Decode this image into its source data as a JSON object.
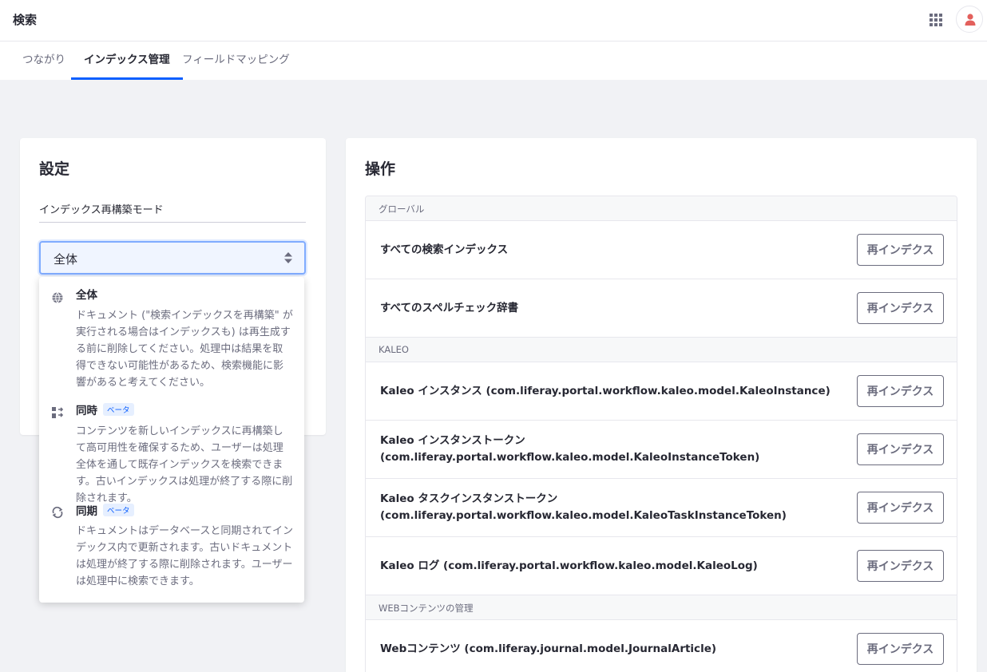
{
  "header": {
    "title": "検索",
    "apps_icon": "apps-grid-icon",
    "avatar_icon": "user-icon",
    "avatar_color": "#e3605c"
  },
  "tabs": [
    {
      "label": "つながり",
      "active": false
    },
    {
      "label": "インデックス管理",
      "active": true
    },
    {
      "label": "フィールドマッピング",
      "active": false
    }
  ],
  "settings": {
    "title": "設定",
    "field_label": "インデックス再構築モード",
    "selected": "全体",
    "options": [
      {
        "title": "全体",
        "badge": "",
        "icon": "globe-icon",
        "description": "ドキュメント (\"検索インデックスを再構築\" が実行される場合はインデックスも) は再生成する前に削除してください。処理中は結果を取得できない可能性があるため、検索機能に影響があると考えてください。"
      },
      {
        "title": "同時",
        "badge": "ベータ",
        "icon": "concurrent-icon",
        "description": "コンテンツを新しいインデックスに再構築して高可用性を確保するため、ユーザーは処理全体を通して既存インデックスを検索できます。古いインデックスは処理が終了する際に削除されます。"
      },
      {
        "title": "同期",
        "badge": "ベータ",
        "icon": "sync-icon",
        "description": "ドキュメントはデータベースと同期されてインデックス内で更新されます。古いドキュメントは処理が終了する際に削除されます。ユーザーは処理中に検索できます。"
      }
    ]
  },
  "operations": {
    "title": "操作",
    "button_label": "再インデクス",
    "groups": [
      {
        "heading": "グローバル"
      },
      {
        "heading": "KALEO"
      },
      {
        "heading": "WEBコンテンツの管理"
      }
    ],
    "rows": [
      {
        "label": "すべての検索インデックス"
      },
      {
        "label": "すべてのスペルチェック辞書"
      },
      {
        "label": "Kaleo インスタンス (com.liferay.portal.workflow.kaleo.model.KaleoInstance)"
      },
      {
        "label": "Kaleo インスタンストークン (com.liferay.portal.workflow.kaleo.model.KaleoInstanceToken)"
      },
      {
        "label": "Kaleo タスクインスタンストークン (com.liferay.portal.workflow.kaleo.model.KaleoTaskInstanceToken)"
      },
      {
        "label": "Kaleo ログ (com.liferay.portal.workflow.kaleo.model.KaleoLog)"
      },
      {
        "label": "Webコンテンツ (com.liferay.journal.model.JournalArticle)"
      }
    ]
  },
  "colors": {
    "accent": "#0b5fff",
    "text": "#272833",
    "secondary": "#6b6c7e",
    "background": "#f1f2f5"
  }
}
